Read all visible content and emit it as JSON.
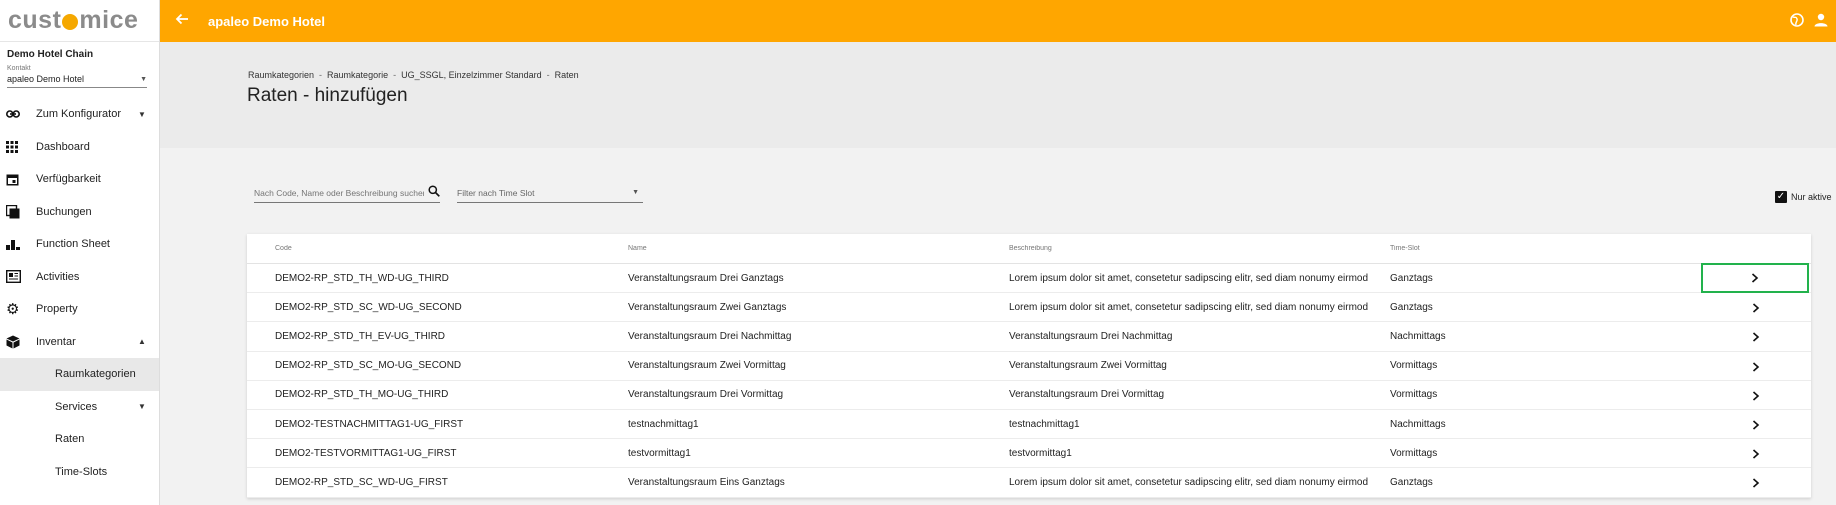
{
  "app": {
    "logo_left": "cust",
    "logo_right": "mice"
  },
  "sidebar": {
    "org_title": "Demo Hotel Chain",
    "context_label": "Kontakt",
    "context_value": "apaleo Demo Hotel",
    "items": [
      {
        "label": "Zum Konfigurator",
        "icon": "link-icon"
      },
      {
        "label": "Dashboard",
        "icon": "grid-icon"
      },
      {
        "label": "Verfügbarkeit",
        "icon": "calendar-icon"
      },
      {
        "label": "Buchungen",
        "icon": "copy-icon"
      },
      {
        "label": "Function Sheet",
        "icon": "bar-chart-icon"
      },
      {
        "label": "Activities",
        "icon": "newspaper-icon"
      },
      {
        "label": "Property",
        "icon": "gear-icon"
      },
      {
        "label": "Inventar",
        "icon": "cube-icon"
      }
    ],
    "sub_items": [
      {
        "label": "Raumkategorien"
      },
      {
        "label": "Services"
      },
      {
        "label": "Raten"
      },
      {
        "label": "Time-Slots"
      }
    ]
  },
  "topbar": {
    "hotel": "apaleo Demo Hotel"
  },
  "header": {
    "breadcrumb": [
      "Raumkategorien",
      "Raumkategorie",
      "UG_SSGL, Einzelzimmer Standard",
      "Raten"
    ],
    "title": "Raten - hinzufügen"
  },
  "filters": {
    "search_placeholder": "Nach Code, Name oder Beschreibung suchen",
    "timeslot_placeholder": "Filter nach Time Slot",
    "only_active_label": "Nur aktive"
  },
  "table": {
    "headers": {
      "code": "Code",
      "name": "Name",
      "desc": "Beschreibung",
      "ts": "Time-Slot"
    },
    "rows": [
      {
        "code": "DEMO2-RP_STD_TH_WD-UG_THIRD",
        "name": "Veranstaltungsraum Drei Ganztags",
        "desc": "Lorem ipsum dolor sit amet, consetetur sadipscing elitr, sed diam nonumy eirmod",
        "ts": "Ganztags"
      },
      {
        "code": "DEMO2-RP_STD_SC_WD-UG_SECOND",
        "name": "Veranstaltungsraum Zwei Ganztags",
        "desc": "Lorem ipsum dolor sit amet, consetetur sadipscing elitr, sed diam nonumy eirmod",
        "ts": "Ganztags"
      },
      {
        "code": "DEMO2-RP_STD_TH_EV-UG_THIRD",
        "name": "Veranstaltungsraum Drei Nachmittag",
        "desc": "Veranstaltungsraum Drei Nachmittag",
        "ts": "Nachmittags"
      },
      {
        "code": "DEMO2-RP_STD_SC_MO-UG_SECOND",
        "name": "Veranstaltungsraum Zwei Vormittag",
        "desc": "Veranstaltungsraum Zwei Vormittag",
        "ts": "Vormittags"
      },
      {
        "code": "DEMO2-RP_STD_TH_MO-UG_THIRD",
        "name": "Veranstaltungsraum Drei Vormittag",
        "desc": "Veranstaltungsraum Drei Vormittag",
        "ts": "Vormittags"
      },
      {
        "code": "DEMO2-TESTNACHMITTAG1-UG_FIRST",
        "name": "testnachmittag1",
        "desc": "testnachmittag1",
        "ts": "Nachmittags"
      },
      {
        "code": "DEMO2-TESTVORMITTAG1-UG_FIRST",
        "name": "testvormittag1",
        "desc": "testvormittag1",
        "ts": "Vormittags"
      },
      {
        "code": "DEMO2-RP_STD_SC_WD-UG_FIRST",
        "name": "Veranstaltungsraum Eins Ganztags",
        "desc": "Lorem ipsum dolor sit amet, consetetur sadipscing elitr, sed diam nonumy eirmod",
        "ts": "Ganztags"
      }
    ]
  },
  "colors": {
    "brand": "#ffa600",
    "highlight": "#22b24c"
  }
}
